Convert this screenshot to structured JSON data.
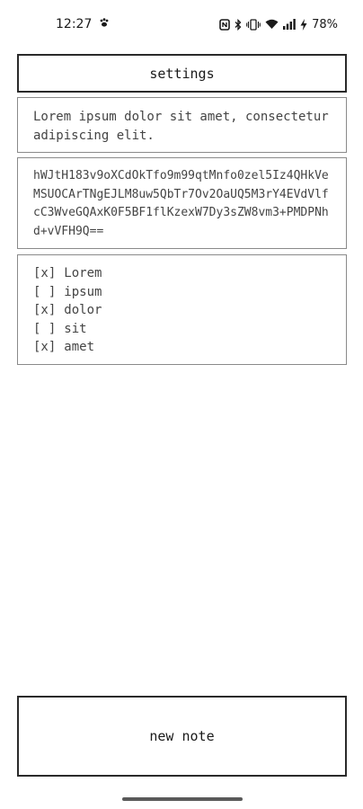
{
  "status_bar": {
    "time": "12:27",
    "battery": "78%",
    "icons": [
      "paw-icon",
      "nfc-icon",
      "bluetooth-icon",
      "vibrate-icon",
      "wifi-icon",
      "signal-icon",
      "charging-icon"
    ]
  },
  "header": {
    "title": "settings"
  },
  "description": {
    "text": "Lorem ipsum dolor sit amet, consectetur adipiscing elit."
  },
  "hash": {
    "text": "hWJtH183v9oXCdOkTfo9m99qtMnfo0zel5Iz4QHkVeMSUOCArTNgEJLM8uw5QbTr7Ov2OaUQ5M3rY4EVdVlfcC3WveGQAxK0F5BF1flKzexW7Dy3sZW8vm3+PMDPNhd+vVFH9Q=="
  },
  "checklist": {
    "items": [
      {
        "mark": "[x]",
        "label": "Lorem"
      },
      {
        "mark": "[ ]",
        "label": "ipsum"
      },
      {
        "mark": "[x]",
        "label": "dolor"
      },
      {
        "mark": "[ ]",
        "label": "sit"
      },
      {
        "mark": "[x]",
        "label": "amet"
      }
    ]
  },
  "footer": {
    "new_note_label": "new note"
  }
}
